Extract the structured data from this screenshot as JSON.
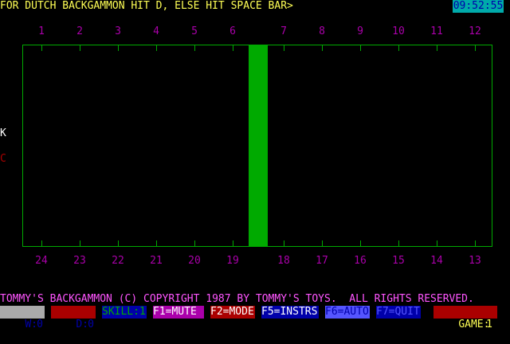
{
  "prompt": "FOR DUTCH BACKGAMMON HIT D, ELSE HIT SPACE BAR>",
  "clock": "09:52:55",
  "top_points": [
    "1",
    "2",
    "3",
    "4",
    "5",
    "6",
    "7",
    "8",
    "9",
    "10",
    "11",
    "12"
  ],
  "bottom_points": [
    "24",
    "23",
    "22",
    "21",
    "20",
    "19",
    "18",
    "17",
    "16",
    "15",
    "14",
    "13"
  ],
  "side_labels": {
    "k": "K",
    "c": "C"
  },
  "copyright": "TOMMY'S BACKGAMMON (C) COPYRIGHT 1987 BY TOMMY'S TOYS.  ALL RIGHTS RESERVED.",
  "status": {
    "w_label": "W:",
    "w_value": "0",
    "d_label": "D:",
    "d_value": "0",
    "skill": "SKILL:1",
    "f1": "F1=MUTE",
    "f2": "F2=MODE",
    "f5": "F5=INSTRS",
    "f6": "F6=AUTO",
    "f7": "F7=QUIT",
    "game_label": "GAME:",
    "game_value": "1"
  },
  "colors": {
    "board": "#00aa00",
    "point_numbers": "#aa00aa",
    "prompt": "#ffff55",
    "copyright": "#ff55ff"
  }
}
